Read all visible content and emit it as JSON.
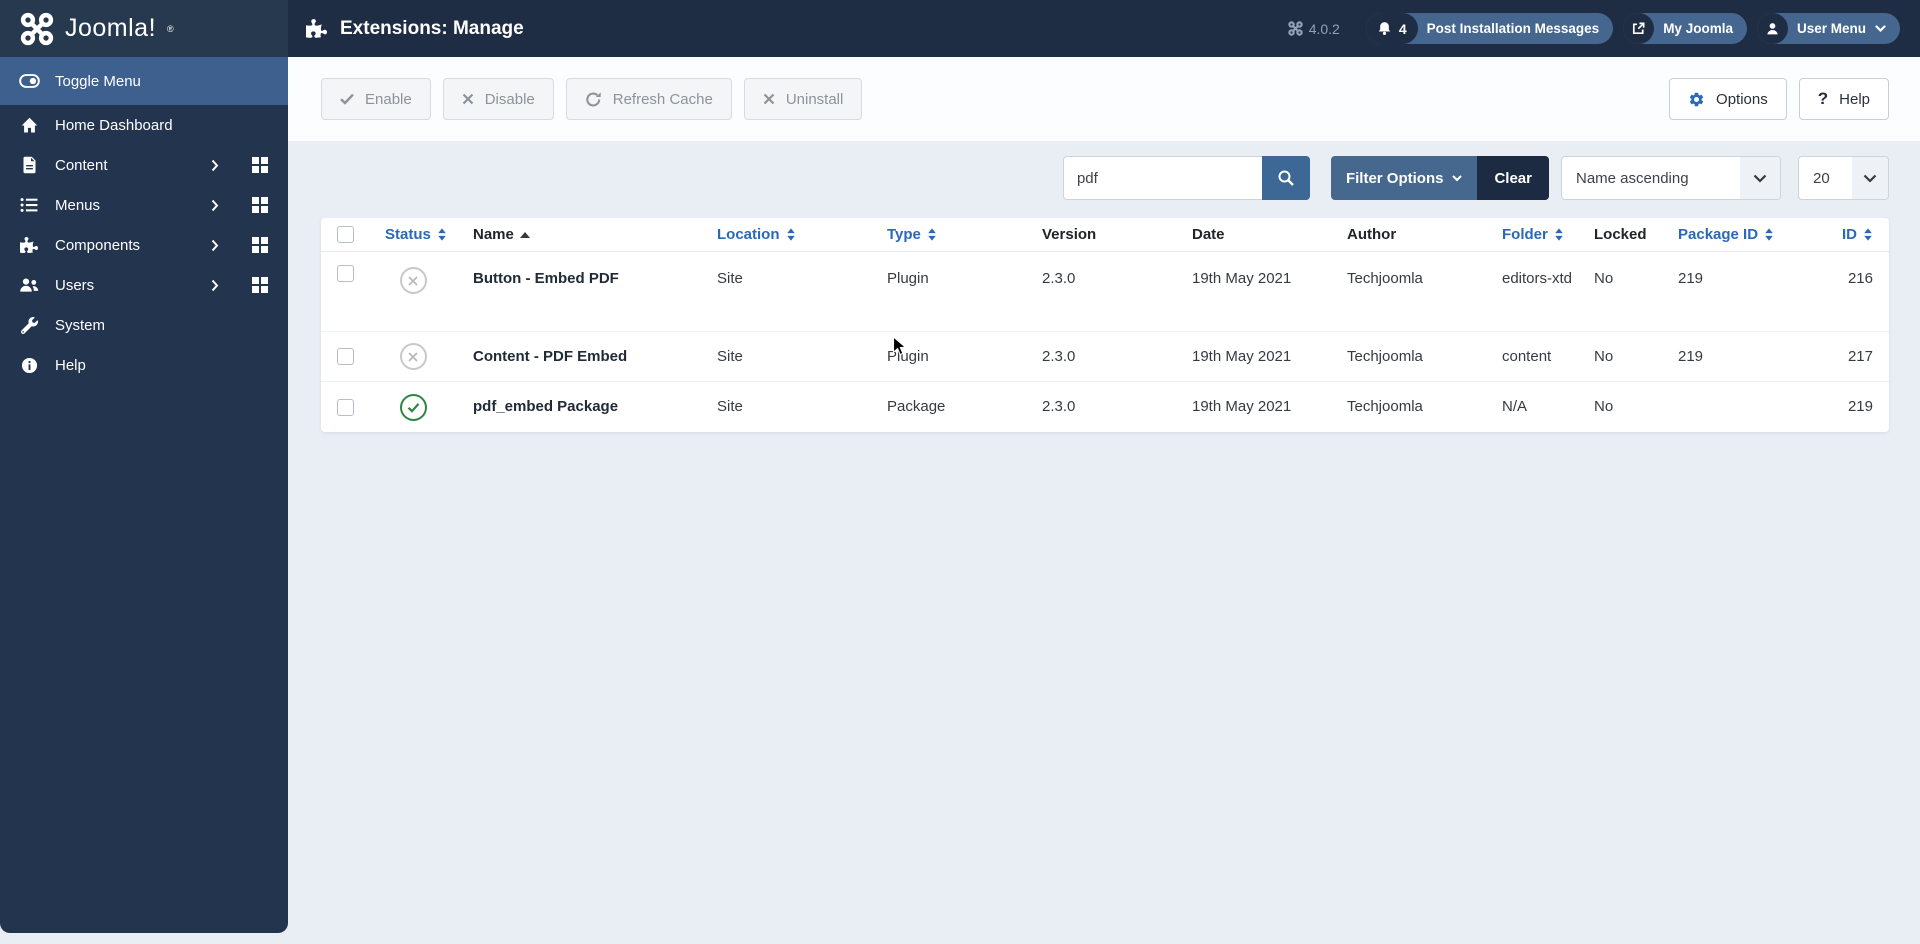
{
  "header": {
    "logo_text": "Joomla!",
    "page_title": "Extensions: Manage",
    "version": "4.0.2",
    "post_installation_count": "4",
    "post_installation_label": "Post Installation Messages",
    "my_joomla_label": "My Joomla",
    "user_menu_label": "User Menu"
  },
  "sidebar": {
    "items": [
      {
        "label": "Toggle Menu",
        "icon": "toggle-icon",
        "active": true
      },
      {
        "label": "Home Dashboard",
        "icon": "home-icon"
      },
      {
        "label": "Content",
        "icon": "document-icon",
        "expandable": true
      },
      {
        "label": "Menus",
        "icon": "list-icon",
        "expandable": true
      },
      {
        "label": "Components",
        "icon": "puzzle-icon",
        "expandable": true
      },
      {
        "label": "Users",
        "icon": "users-icon",
        "expandable": true
      },
      {
        "label": "System",
        "icon": "wrench-icon"
      },
      {
        "label": "Help",
        "icon": "info-icon"
      }
    ]
  },
  "toolbar": {
    "enable_label": "Enable",
    "disable_label": "Disable",
    "refresh_cache_label": "Refresh Cache",
    "uninstall_label": "Uninstall",
    "options_label": "Options",
    "help_label": "Help"
  },
  "filters": {
    "search_value": "pdf",
    "filter_options_label": "Filter Options",
    "clear_label": "Clear",
    "sort_value": "Name ascending",
    "page_size_value": "20"
  },
  "table": {
    "columns": [
      {
        "label": "Status",
        "sortable": true
      },
      {
        "label": "Name",
        "sortable": true,
        "sorted": "ascending"
      },
      {
        "label": "Location",
        "sortable": true
      },
      {
        "label": "Type",
        "sortable": true
      },
      {
        "label": "Version",
        "sortable": false
      },
      {
        "label": "Date",
        "sortable": false
      },
      {
        "label": "Author",
        "sortable": false
      },
      {
        "label": "Folder",
        "sortable": true
      },
      {
        "label": "Locked",
        "sortable": false
      },
      {
        "label": "Package ID",
        "sortable": true
      },
      {
        "label": "ID",
        "sortable": true
      }
    ],
    "rows": [
      {
        "status": "disabled",
        "name": "Button - Embed PDF",
        "location": "Site",
        "type": "Plugin",
        "version": "2.3.0",
        "date": "19th May 2021",
        "author": "Techjoomla",
        "folder": "editors-xtd",
        "locked": "No",
        "package_id": "219",
        "id": "216"
      },
      {
        "status": "disabled",
        "name": "Content - PDF Embed",
        "location": "Site",
        "type": "Plugin",
        "version": "2.3.0",
        "date": "19th May 2021",
        "author": "Techjoomla",
        "folder": "content",
        "locked": "No",
        "package_id": "219",
        "id": "217"
      },
      {
        "status": "enabled",
        "name": "pdf_embed Package",
        "location": "Site",
        "type": "Package",
        "version": "2.3.0",
        "date": "19th May 2021",
        "author": "Techjoomla",
        "folder": "N/A",
        "locked": "No",
        "package_id": "",
        "id": "219"
      }
    ]
  },
  "colors": {
    "header_bg": "#1f2d44",
    "sidebar_bg": "#22344e",
    "active_item_bg": "#3d608f",
    "pill_bg": "#45678f",
    "link_blue": "#2a69b8",
    "filter_button_blue": "#46688f",
    "clear_button_dark": "#1c2b42",
    "search_button_blue": "#3d6795",
    "success_green": "#2e8540",
    "disabled_gray": "#c8c8c8",
    "content_bg": "#e9edf4"
  }
}
